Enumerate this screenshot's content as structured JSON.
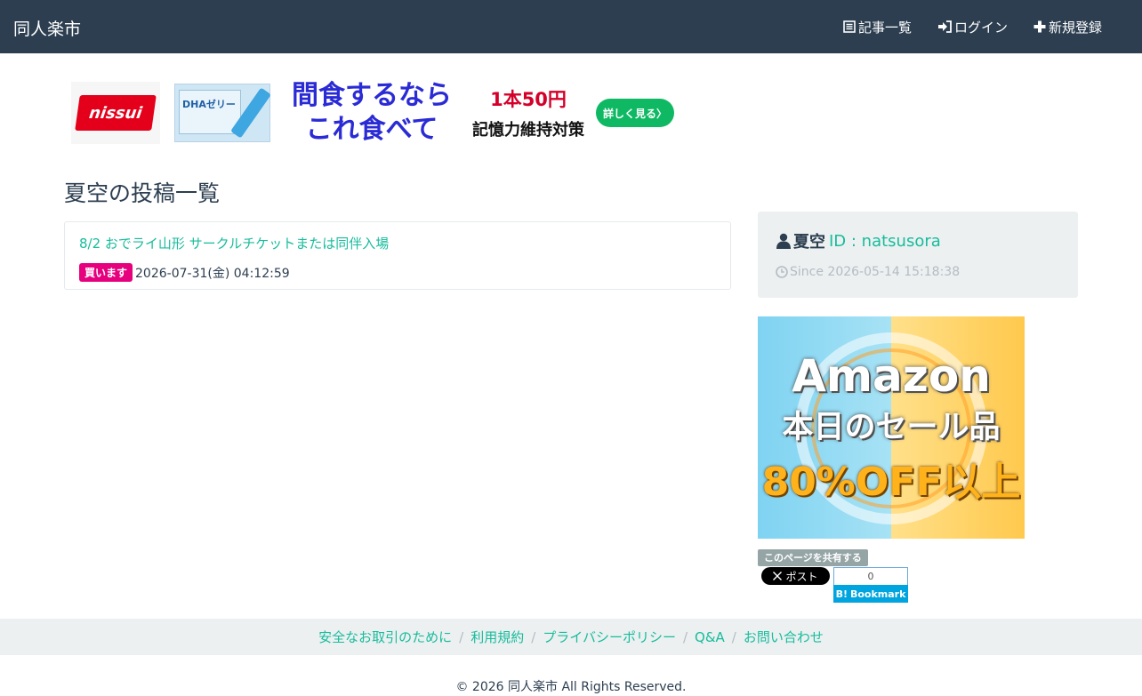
{
  "navbar": {
    "brand": "同人楽市",
    "links": [
      {
        "label": "記事一覧",
        "icon": "list-alt-icon"
      },
      {
        "label": "ログイン",
        "icon": "log-in-icon"
      },
      {
        "label": "新規登録",
        "icon": "plus-icon"
      }
    ]
  },
  "banner_ad": {
    "brand": "nissui",
    "product_name": "DHAゼリー",
    "headline_line1": "間食するなら",
    "headline_line2": "これ食べて",
    "price": "1本50円",
    "tagline": "記憶力維持対策",
    "cta": "詳しく見る〉"
  },
  "page": {
    "title": "夏空の投稿一覧"
  },
  "posts": [
    {
      "title": "8/2 おでライ山形 サークルチケットまたは同伴入場",
      "badge": "買います",
      "datetime": "2026-07-31(金) 04:12:59"
    }
  ],
  "profile": {
    "name": "夏空",
    "id_label": "ID : natsusora",
    "since": "Since 2026-05-14 15:18:38"
  },
  "side_ad": {
    "line1": "Amazon",
    "line2": "本日のセール品",
    "line3": "80%OFF以上"
  },
  "share": {
    "label": "このページを共有する",
    "x_post": "ポスト",
    "hatena_count": "0",
    "hatena_label": "Bookmark"
  },
  "footer": {
    "links": [
      "安全なお取引のために",
      "利用規約",
      "プライバシーポリシー",
      "Q&A",
      "お問い合わせ"
    ],
    "copyright": "© 2026 同人楽市 All Rights Reserved."
  },
  "colors": {
    "navbar_bg": "#2c3e50",
    "accent": "#18bc9c",
    "badge_buy": "#e6007e",
    "panel_bg": "#ecf0f1"
  }
}
